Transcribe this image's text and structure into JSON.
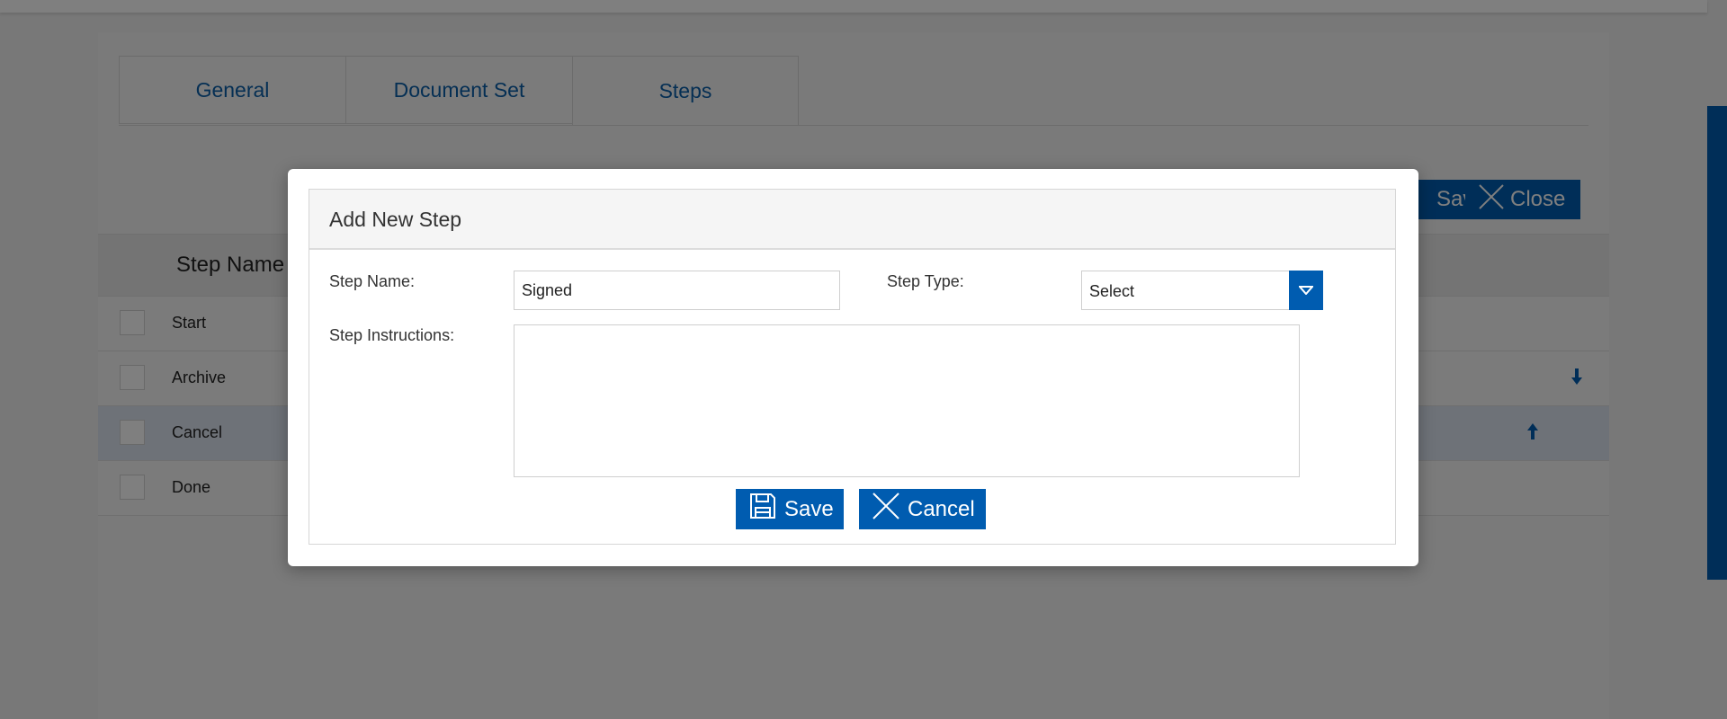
{
  "tabs": [
    {
      "label": "General"
    },
    {
      "label": "Document Set"
    },
    {
      "label": "Steps"
    }
  ],
  "toolbar": {
    "save_label": "Save",
    "close_label": "Close"
  },
  "grid": {
    "header": "Step Name",
    "rows": [
      {
        "name": "Start"
      },
      {
        "name": "Archive"
      },
      {
        "name": "Cancel"
      },
      {
        "name": "Done"
      }
    ]
  },
  "modal": {
    "title": "Add New Step",
    "step_name_label": "Step Name:",
    "step_name_value": "Signed",
    "step_type_label": "Step Type:",
    "step_type_value": "Select",
    "instructions_label": "Step Instructions:",
    "instructions_value": "",
    "save_label": "Save",
    "cancel_label": "Cancel"
  },
  "colors": {
    "accent": "#005cb0",
    "tab_text": "#0a5ea8",
    "selected_row": "#dde4f0"
  }
}
